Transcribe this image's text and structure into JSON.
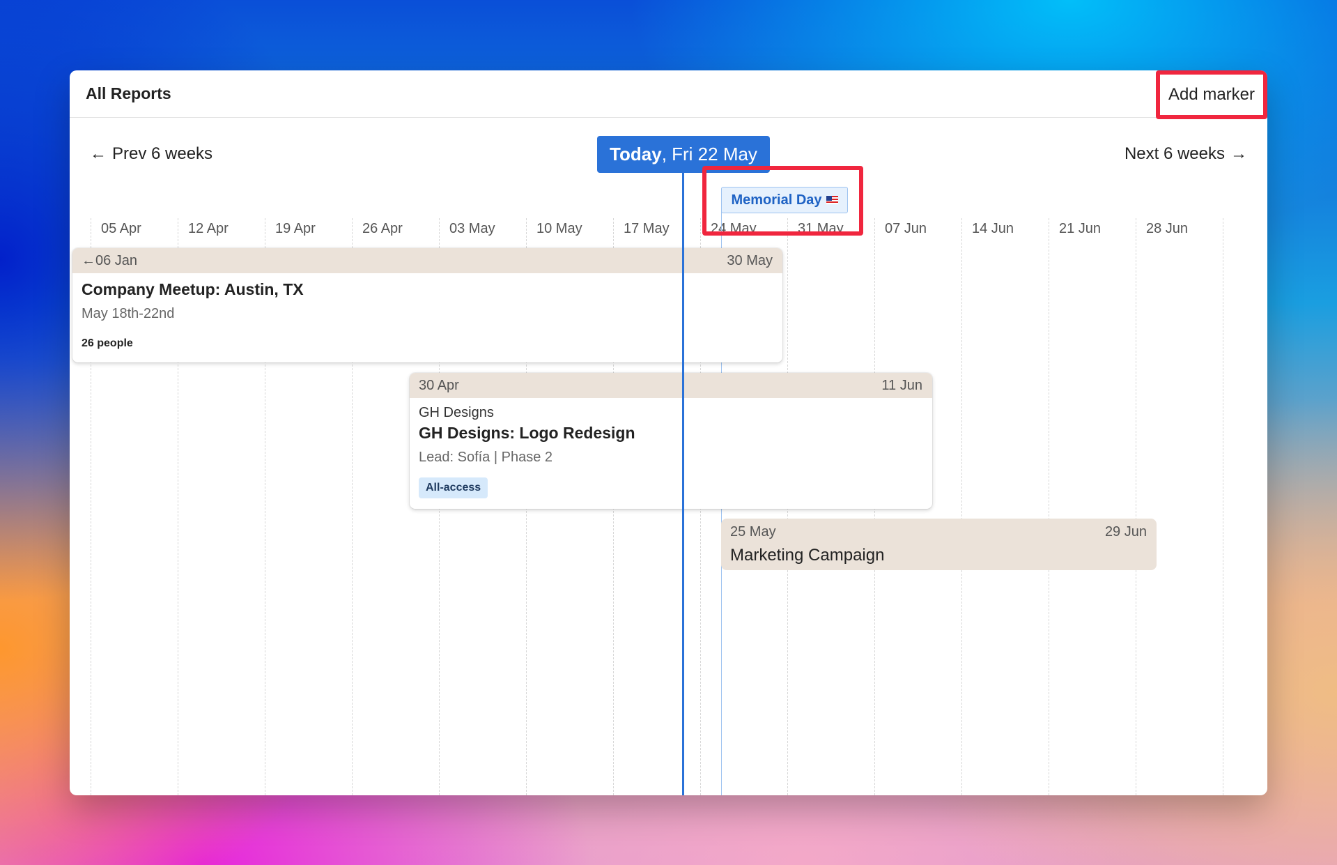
{
  "header": {
    "title": "All Reports",
    "add_marker": "Add marker"
  },
  "nav": {
    "prev_label": "Prev 6 weeks",
    "next_label": "Next 6 weeks",
    "today_strong": "Today",
    "today_rest": ", Fri 22 May"
  },
  "weeks": [
    "05 Apr",
    "12 Apr",
    "19 Apr",
    "26 Apr",
    "03 May",
    "10 May",
    "17 May",
    "24 May",
    "31 May",
    "07 Jun",
    "14 Jun",
    "21 Jun",
    "28 Jun"
  ],
  "marker": {
    "label": "Memorial Day",
    "icon": "us-flag-icon"
  },
  "cards": [
    {
      "start": "←06 Jan",
      "end": "30 May",
      "title": "Company Meetup: Austin, TX",
      "subtitle": "May 18th-22nd",
      "meta": "26 people"
    },
    {
      "start": "30 Apr",
      "end": "11 Jun",
      "client": "GH Designs",
      "title": "GH Designs: Logo Redesign",
      "subtitle": "Lead: Sofía | Phase 2",
      "tag": "All-access"
    },
    {
      "start": "25 May",
      "end": "29 Jun",
      "title": "Marketing Campaign"
    }
  ],
  "colors": {
    "accent": "#2a72d8",
    "highlight": "#f0263e",
    "card_header": "#ebe2d9",
    "tag_bg": "#d6e9fb"
  }
}
